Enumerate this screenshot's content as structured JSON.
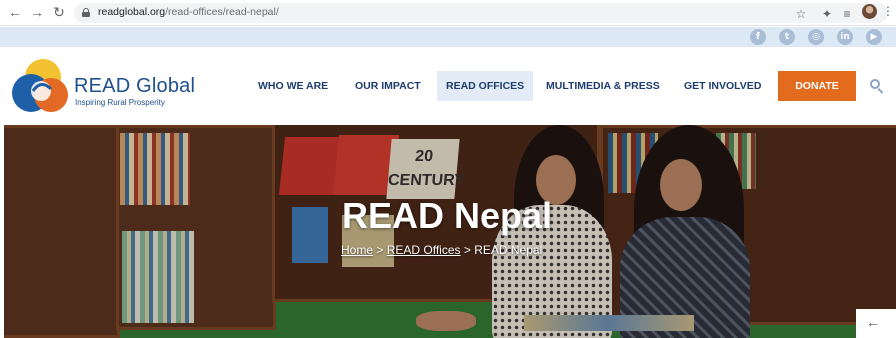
{
  "browser": {
    "url_domain": "readglobal.org",
    "url_path": "/read-offices/read-nepal/",
    "icons": [
      "arrow-left-icon",
      "arrow-right-icon",
      "reload-icon",
      "lock-icon",
      "star-icon",
      "puzzle-icon",
      "media-queue-icon",
      "avatar",
      "kebab-menu-icon"
    ]
  },
  "social": {
    "items": [
      {
        "name": "facebook-icon",
        "glyph": "f"
      },
      {
        "name": "twitter-icon",
        "glyph": "t"
      },
      {
        "name": "instagram-icon",
        "glyph": "◎"
      },
      {
        "name": "linkedin-icon",
        "glyph": "in"
      },
      {
        "name": "youtube-icon",
        "glyph": "▶"
      }
    ],
    "color": "#a9bdd7"
  },
  "header": {
    "logo_name": "READ Global",
    "logo_tagline": "Inspiring Rural Prosperity",
    "menu": [
      {
        "label": "WHO WE ARE"
      },
      {
        "label": "OUR IMPACT"
      },
      {
        "label": "READ OFFICES",
        "active": true
      },
      {
        "label": "MULTIMEDIA & PRESS"
      },
      {
        "label": "GET INVOLVED"
      }
    ],
    "donate_label": "DONATE",
    "brand_color": "#1f4f8c",
    "accent_color": "#e36b1e"
  },
  "hero": {
    "title": "READ Nepal",
    "breadcrumb": {
      "home": "Home",
      "sep1": " > ",
      "offices": "READ Offices",
      "sep2": " > ",
      "current": "READ Nepal"
    },
    "book_cover_text": "20 CENTURY"
  },
  "scroll_arrow": "←"
}
